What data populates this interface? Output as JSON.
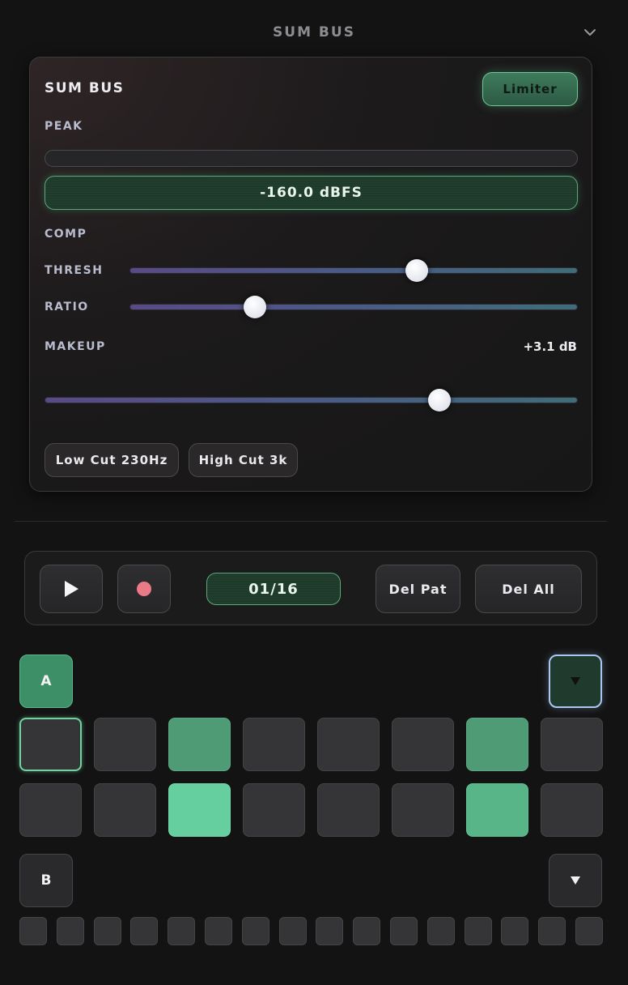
{
  "header": {
    "title": "SUM BUS",
    "collapse_icon": "chevron-down-icon"
  },
  "bus": {
    "title": "SUM BUS",
    "limiter_label": "Limiter",
    "peak_label": "PEAK",
    "peak_level": 0,
    "peak_readout": "-160.0 dBFS",
    "comp_label": "COMP",
    "thresh_label": "THRESH",
    "thresh_value": 0.64,
    "ratio_label": "RATIO",
    "ratio_value": 0.28,
    "makeup_label": "MAKEUP",
    "makeup_readout": "+3.1 dB",
    "makeup_value": 0.74,
    "low_cut_label": "Low Cut 230Hz",
    "high_cut_label": "High Cut 3k"
  },
  "transport": {
    "play_icon": "play-icon",
    "record_icon": "record-icon",
    "step_display": "01/16",
    "del_pat_label": "Del Pat",
    "del_all_label": "Del All"
  },
  "pattern_a": {
    "label": "A",
    "dropdown_icon": "triangle-down-icon",
    "row1": [
      "sel",
      "off",
      "on",
      "off",
      "off",
      "off",
      "on",
      "off"
    ],
    "row2": [
      "off",
      "off",
      "bright",
      "off",
      "off",
      "off",
      "mid",
      "off"
    ]
  },
  "pattern_b": {
    "label": "B",
    "dropdown_icon": "triangle-down-icon",
    "steps": 16
  },
  "colors": {
    "accent": "#4e9b76",
    "accent_bright": "#66cf9f",
    "record": "#ea7a85",
    "focus": "#a9c6f0"
  }
}
